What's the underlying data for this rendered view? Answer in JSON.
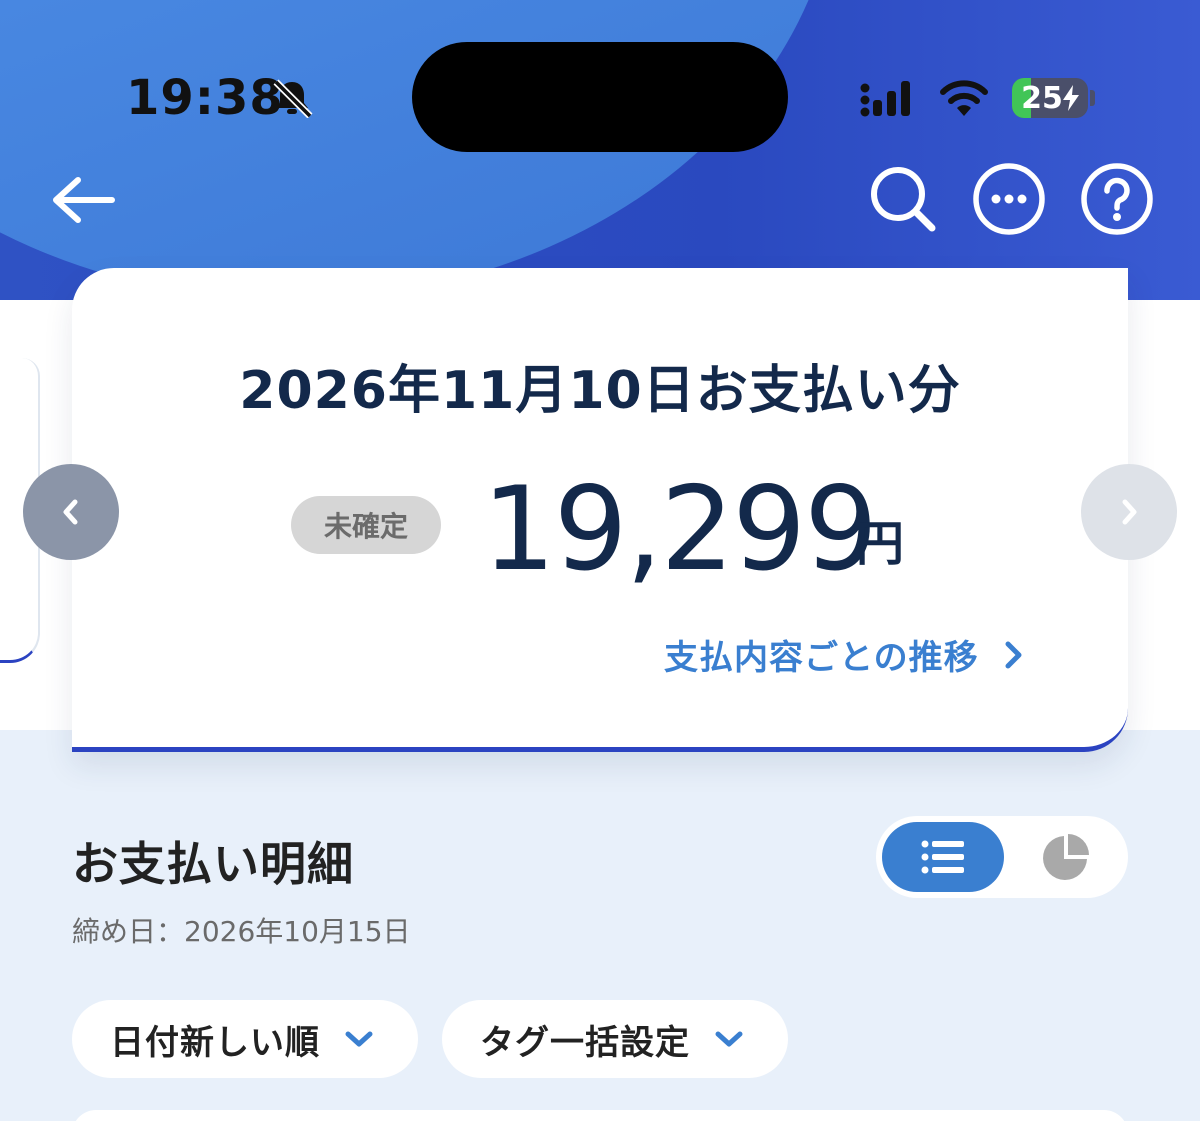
{
  "status_bar": {
    "time": "19:38",
    "battery_level": "25",
    "battery_fraction": 0.25
  },
  "header": {
    "icons": [
      "back-arrow-icon",
      "search-icon",
      "more-icon",
      "help-icon"
    ]
  },
  "summary_card": {
    "title": "2026年11月10日お支払い分",
    "status_badge": "未確定",
    "amount": "19,299",
    "currency": "円",
    "trend_link": "支払内容ごとの推移"
  },
  "details": {
    "title": "お支払い明細",
    "closing_date": "締め日：2026年10月15日",
    "view_modes": [
      "list",
      "pie"
    ],
    "active_view": "list"
  },
  "filters": {
    "sort_label": "日付新しい順",
    "tag_label": "タグ一括設定"
  },
  "colors": {
    "header_blue": "#2f52c4",
    "accent_blue": "#3a7fd0",
    "navy_text": "#13294b",
    "card_border": "#2b43c1"
  }
}
